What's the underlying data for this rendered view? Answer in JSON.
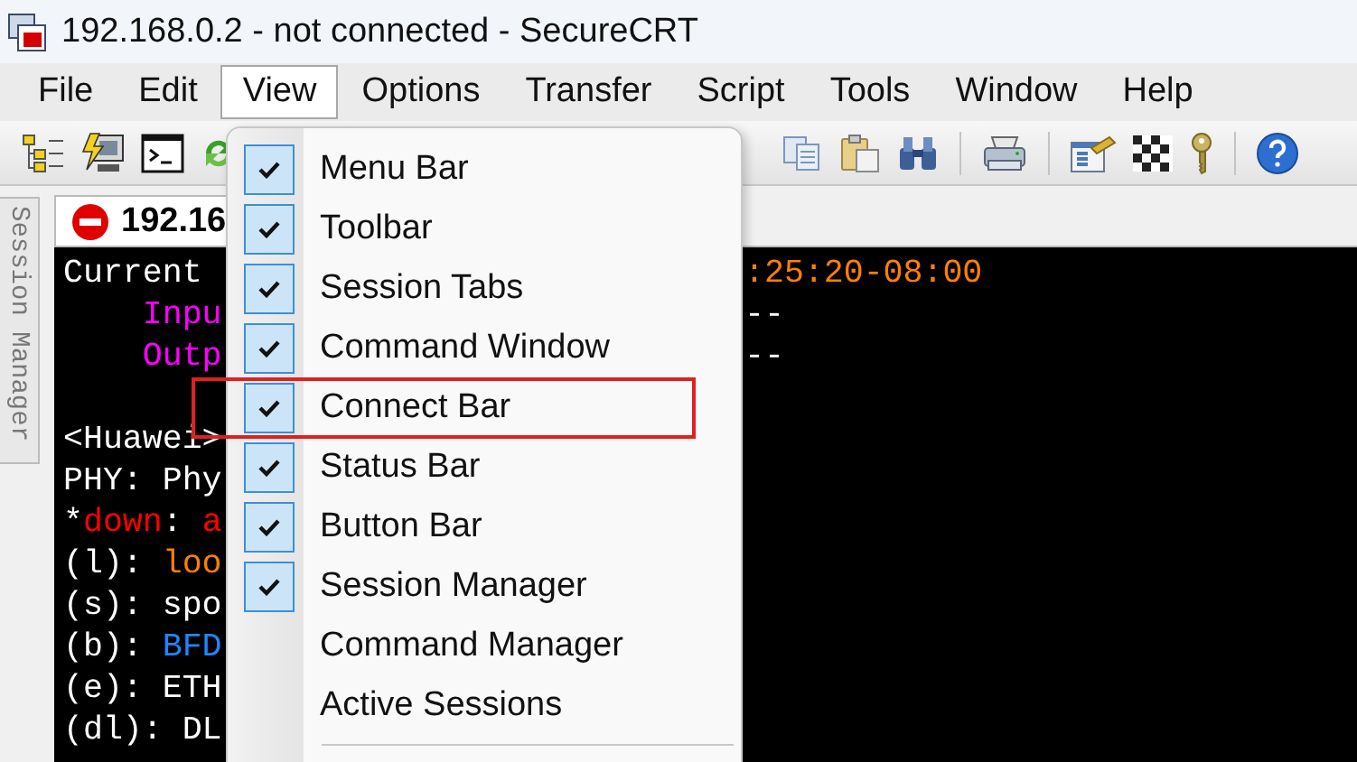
{
  "window": {
    "title": "192.168.0.2 - not connected - SecureCRT"
  },
  "menu_bar": [
    {
      "label": "File",
      "selected": false
    },
    {
      "label": "Edit",
      "selected": false
    },
    {
      "label": "View",
      "selected": true
    },
    {
      "label": "Options",
      "selected": false
    },
    {
      "label": "Transfer",
      "selected": false
    },
    {
      "label": "Script",
      "selected": false
    },
    {
      "label": "Tools",
      "selected": false
    },
    {
      "label": "Window",
      "selected": false
    },
    {
      "label": "Help",
      "selected": false
    }
  ],
  "side_panel": {
    "label": "Session Manager"
  },
  "session_tab": {
    "label": "192.16"
  },
  "terminal": {
    "lines": [
      {
        "kind": "text",
        "left": [
          {
            "text": "Current",
            "color": "#ffffff"
          }
        ],
        "right": [
          {
            "text": ":25:20-08:00",
            "color": "#ff8000"
          }
        ]
      },
      {
        "kind": "text",
        "left": [
          {
            "text": "    Inpu",
            "color": "#ff00ff"
          }
        ],
        "right": [
          {
            "text": "--",
            "color": "#ffffff"
          }
        ]
      },
      {
        "kind": "text",
        "left": [
          {
            "text": "    Outp",
            "color": "#ff00ff"
          }
        ],
        "right": [
          {
            "text": "--",
            "color": "#ffffff"
          }
        ]
      },
      {
        "kind": "blank"
      },
      {
        "kind": "text",
        "left": [
          {
            "text": "<Huawei>",
            "color": "#ffffff"
          }
        ]
      },
      {
        "kind": "text",
        "left": [
          {
            "text": "PHY: Phy",
            "color": "#ffffff"
          }
        ]
      },
      {
        "kind": "text",
        "left": [
          {
            "text": "*",
            "color": "#ffffff"
          },
          {
            "text": "down",
            "color": "#ff0000"
          },
          {
            "text": ": ",
            "color": "#ffffff"
          },
          {
            "text": "a",
            "color": "#ff0000"
          }
        ]
      },
      {
        "kind": "text",
        "left": [
          {
            "text": "(l): ",
            "color": "#ffffff"
          },
          {
            "text": "loo",
            "color": "#ff8000"
          }
        ]
      },
      {
        "kind": "text",
        "left": [
          {
            "text": "(s): spo",
            "color": "#ffffff"
          }
        ]
      },
      {
        "kind": "text",
        "left": [
          {
            "text": "(b): ",
            "color": "#ffffff"
          },
          {
            "text": "BFD",
            "color": "#1e86ff"
          }
        ]
      },
      {
        "kind": "text",
        "left": [
          {
            "text": "(e): ETH",
            "color": "#ffffff"
          }
        ]
      },
      {
        "kind": "text",
        "left": [
          {
            "text": "(dl): DL",
            "color": "#ffffff"
          }
        ]
      }
    ]
  },
  "view_menu": {
    "items": [
      {
        "label": "Menu Bar",
        "checked": true,
        "highlighted": false
      },
      {
        "label": "Toolbar",
        "checked": true,
        "highlighted": false
      },
      {
        "label": "Session Tabs",
        "checked": true,
        "highlighted": false
      },
      {
        "label": "Command Window",
        "checked": true,
        "highlighted": false
      },
      {
        "label": "Connect Bar",
        "checked": true,
        "highlighted": true
      },
      {
        "label": "Status Bar",
        "checked": true,
        "highlighted": false
      },
      {
        "label": "Button Bar",
        "checked": true,
        "highlighted": false
      },
      {
        "label": "Session Manager",
        "checked": true,
        "highlighted": false
      },
      {
        "label": "Command Manager",
        "checked": false,
        "highlighted": false
      },
      {
        "label": "Active Sessions",
        "checked": false,
        "highlighted": false
      }
    ]
  }
}
